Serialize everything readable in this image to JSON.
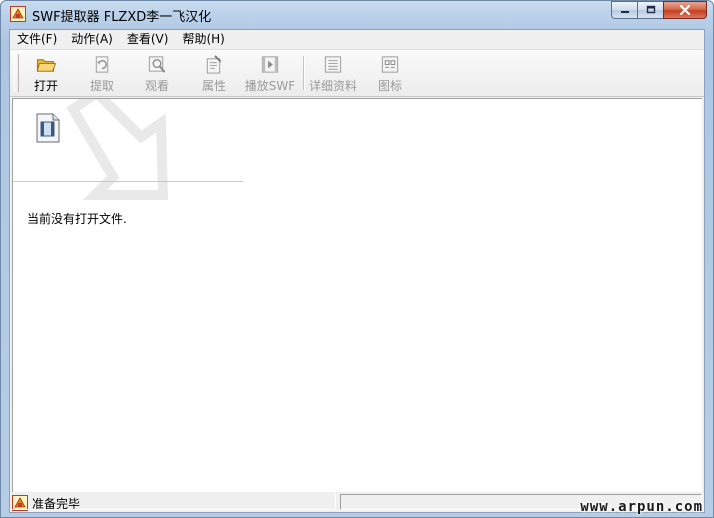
{
  "window": {
    "title": "SWF提取器  FLZXD李一飞汉化",
    "icon": "swf-extractor-icon"
  },
  "menu": [
    {
      "label": "文件(F)"
    },
    {
      "label": "动作(A)"
    },
    {
      "label": "查看(V)"
    },
    {
      "label": "帮助(H)"
    }
  ],
  "toolbar": {
    "buttons": [
      {
        "label": "打开",
        "icon": "folder-open-icon",
        "enabled": true
      },
      {
        "label": "提取",
        "icon": "extract-icon",
        "enabled": false
      },
      {
        "label": "观看",
        "icon": "view-icon",
        "enabled": false
      },
      {
        "label": "属性",
        "icon": "properties-icon",
        "enabled": false
      },
      {
        "label": "播放SWF",
        "icon": "play-swf-icon",
        "enabled": false
      },
      {
        "label": "详细资料",
        "icon": "details-icon",
        "enabled": false
      },
      {
        "label": "图标",
        "icon": "large-icons-icon",
        "enabled": false
      }
    ]
  },
  "content": {
    "empty_message": "当前没有打开文件."
  },
  "status": {
    "text": "准备完毕"
  },
  "watermark": {
    "text": "www.arpun.com"
  },
  "colors": {
    "title_bar": "#b8cfe8",
    "close_button": "#c43f20",
    "folder_yellow": "#f0c64a"
  }
}
